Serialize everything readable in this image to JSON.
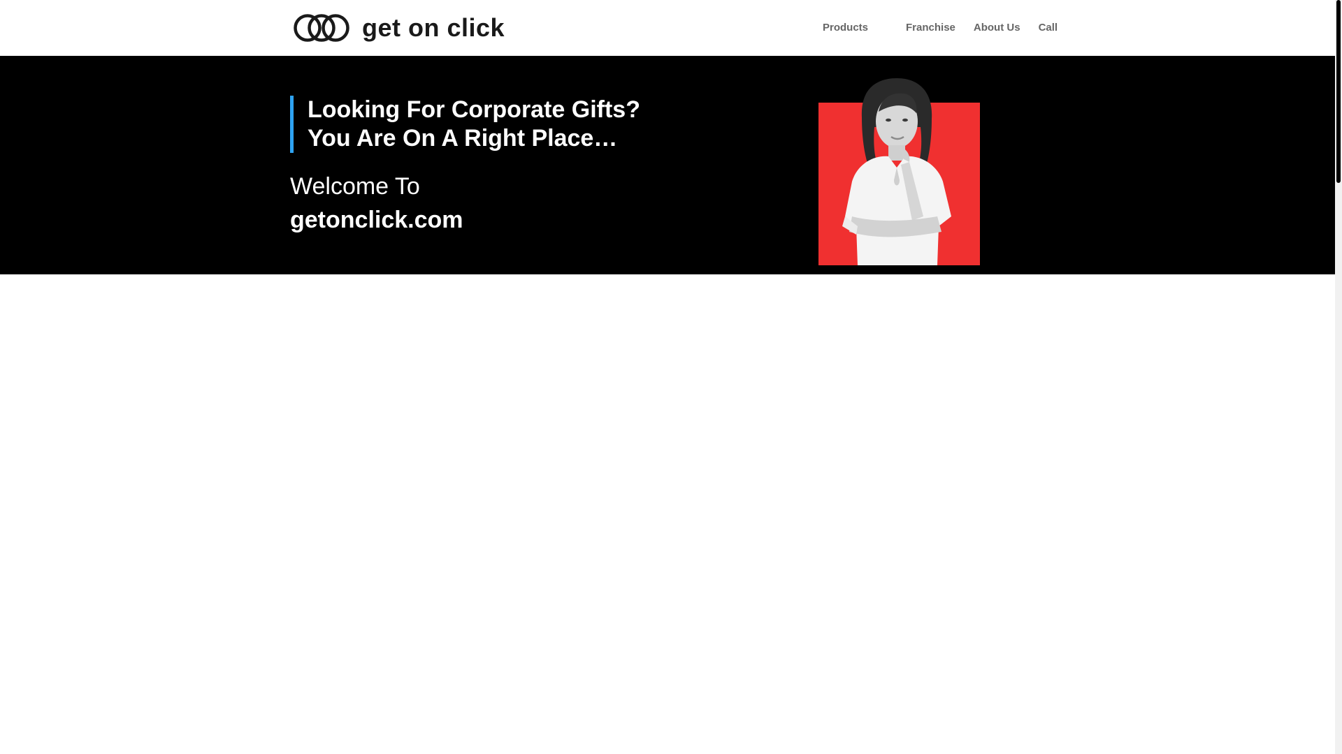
{
  "header": {
    "logo_text": "get on click",
    "nav": [
      {
        "label": "Products"
      },
      {
        "label": "Franchise"
      },
      {
        "label": "About Us"
      },
      {
        "label": "Call"
      }
    ]
  },
  "hero": {
    "headline_line1": "Looking For Corporate Gifts?",
    "headline_line2": "You Are On A Right Place…",
    "welcome": "Welcome To",
    "site_name": "getonclick.com"
  },
  "colors": {
    "hero_background": "#000000",
    "accent_border": "#2ea3f2",
    "photo_background": "#f03030",
    "nav_text": "#666666"
  },
  "icons": {
    "logo_mark": "three-interlocked-rings-icon"
  }
}
